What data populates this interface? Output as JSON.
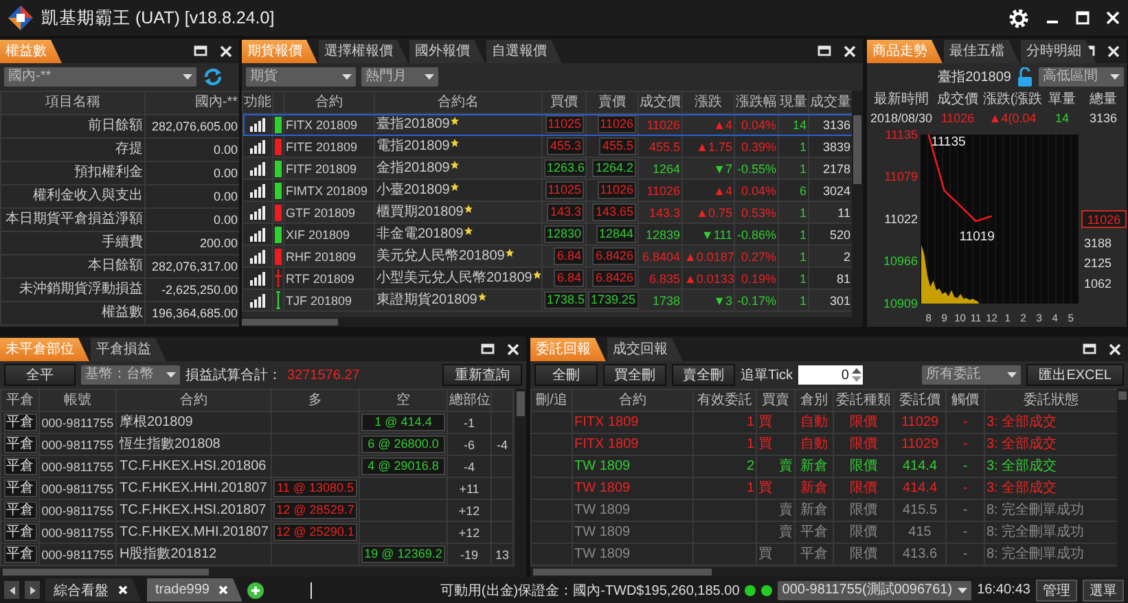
{
  "window": {
    "title": "凱基期霸王 (UAT) [v18.8.24.0]"
  },
  "equity_panel": {
    "tabs": [
      {
        "label": "權益數",
        "selected": true
      }
    ],
    "market_select": {
      "value": "國內-**"
    },
    "columns": [
      "項目名稱",
      "國內-**"
    ],
    "rows": [
      {
        "label": "前日餘額",
        "value": "282,076,605.00"
      },
      {
        "label": "存提",
        "value": "0.00"
      },
      {
        "label": "預扣權利金",
        "value": "0.00"
      },
      {
        "label": "權利金收入與支出",
        "value": "0.00"
      },
      {
        "label": "本日期貨平倉損益淨額",
        "value": "0.00"
      },
      {
        "label": "手續費",
        "value": "200.00"
      },
      {
        "label": "本日餘額",
        "value": "282,076,317.00"
      },
      {
        "label": "未沖銷期貨浮動損益",
        "value": "-2,625,250.00"
      },
      {
        "label": "權益數",
        "value": "196,364,685.00"
      }
    ]
  },
  "quote_panel": {
    "tabs": [
      {
        "label": "期貨報價",
        "selected": true
      },
      {
        "label": "選擇權報價",
        "selected": false
      },
      {
        "label": "國外報價",
        "selected": false
      },
      {
        "label": "自選報價",
        "selected": false
      }
    ],
    "filters": [
      {
        "value": "期貨"
      },
      {
        "value": "熱門月"
      }
    ],
    "columns": [
      "功能",
      "合約",
      "合約名",
      "買價",
      "賣價",
      "成交價",
      "漲跌",
      "漲跌幅",
      "現量",
      "成交量"
    ],
    "rows": [
      {
        "symbol": "FITX 201809",
        "name": "臺指201809",
        "starred": true,
        "color": "#2ed12e",
        "kind": "bar",
        "rising": true,
        "bid": "11025",
        "ask": "11026",
        "last": "11026",
        "change": "▲4",
        "change_pct": "0.04%",
        "tick_volume": "14",
        "volume": "3136",
        "selected": true
      },
      {
        "symbol": "FITE 201809",
        "name": "電指201809",
        "starred": true,
        "color": "#ee1c1c",
        "kind": "bar",
        "rising": true,
        "bid": "455.3",
        "ask": "455.5",
        "last": "455.5",
        "change": "▲1.75",
        "change_pct": "0.39%",
        "tick_volume": "1",
        "volume": "3839",
        "selected": false
      },
      {
        "symbol": "FITF 201809",
        "name": "金指201809",
        "starred": true,
        "color": "#2ed12e",
        "kind": "bar",
        "rising": false,
        "bid": "1263.6",
        "ask": "1264.2",
        "last": "1264",
        "change": "▼7",
        "change_pct": "-0.55%",
        "tick_volume": "1",
        "volume": "2178",
        "selected": false
      },
      {
        "symbol": "FIMTX 201809",
        "name": "小臺201809",
        "starred": true,
        "color": "#2ed12e",
        "kind": "bar",
        "rising": true,
        "bid": "11025",
        "ask": "11026",
        "last": "11026",
        "change": "▲4",
        "change_pct": "0.04%",
        "tick_volume": "6",
        "volume": "3024",
        "selected": false
      },
      {
        "symbol": "GTF 201809",
        "name": "櫃買期201809",
        "starred": true,
        "color": "#ee1c1c",
        "kind": "bar",
        "rising": true,
        "bid": "143.3",
        "ask": "143.65",
        "last": "143.3",
        "change": "▲0.75",
        "change_pct": "0.53%",
        "tick_volume": "1",
        "volume": "11",
        "selected": false
      },
      {
        "symbol": "XIF 201809",
        "name": "非金電201809",
        "starred": true,
        "color": "#2ed12e",
        "kind": "bar",
        "rising": false,
        "bid": "12830",
        "ask": "12844",
        "last": "12839",
        "change": "▼111",
        "change_pct": "-0.86%",
        "tick_volume": "1",
        "volume": "520",
        "selected": false
      },
      {
        "symbol": "RHF 201809",
        "name": "美元兌人民幣201809",
        "starred": true,
        "color": "#ee1c1c",
        "kind": "bar",
        "rising": true,
        "bid": "6.84",
        "ask": "6.8426",
        "last": "6.8404",
        "change": "▲0.0187",
        "change_pct": "0.27%",
        "tick_volume": "1",
        "volume": "2",
        "selected": false
      },
      {
        "symbol": "RTF 201809",
        "name": "小型美元兌人民幣201809",
        "starred": true,
        "color": "#ee1c1c",
        "kind": "cross",
        "rising": true,
        "bid": "6.84",
        "ask": "6.8426",
        "last": "6.835",
        "change": "▲0.0133",
        "change_pct": "0.19%",
        "tick_volume": "1",
        "volume": "81",
        "selected": false
      },
      {
        "symbol": "TJF 201809",
        "name": "東證期貨201809",
        "starred": true,
        "color": "#2ed12e",
        "kind": "line",
        "rising": false,
        "bid": "1738.5",
        "ask": "1739.25",
        "last": "1738",
        "change": "▼3",
        "change_pct": "-0.17%",
        "tick_volume": "1",
        "volume": "301",
        "selected": false
      }
    ]
  },
  "chart_panel": {
    "tabs": [
      {
        "label": "商品走勢",
        "selected": true
      },
      {
        "label": "最佳五檔",
        "selected": false
      },
      {
        "label": "分時明細",
        "selected": false
      }
    ],
    "symbol": "臺指201809",
    "locked": false,
    "range_select": {
      "value": "高低區間"
    },
    "columns": [
      "最新時間",
      "成交價",
      "漲跌(漲跌",
      "單量",
      "總量"
    ],
    "ticker": {
      "time": "2018/08/30",
      "last": "11026",
      "change": "▲4(0.04",
      "tick_volume": "14",
      "total_volume": "3136",
      "rising": true
    },
    "last_price_tag": "11026",
    "chart_data": {
      "type": "line",
      "categories": [
        "8",
        "9",
        "10",
        "11",
        "12",
        "1",
        "2",
        "3",
        "4",
        "5"
      ],
      "ylim": [
        10909,
        11135
      ],
      "yticks": [
        10909,
        10966,
        11022,
        11079,
        11135
      ],
      "series": [
        {
          "color": "#ff1a1a",
          "values": [
            11135,
            11060,
            11040,
            11019,
            11026,
            null,
            null,
            null,
            null,
            null
          ]
        }
      ],
      "annotations": [
        {
          "text": "11135"
        },
        {
          "text": "11019"
        }
      ]
    },
    "volume_axis_labels": [
      "3188",
      "2125",
      "1062"
    ]
  },
  "positions_panel": {
    "tabs": [
      {
        "label": "未平倉部位",
        "selected": true
      },
      {
        "label": "平倉損益",
        "selected": false
      }
    ],
    "close_all_button": "全平",
    "currency_select": {
      "value": "基幣：台幣"
    },
    "pnl_label": "損益試算合計：",
    "pnl_value": "3271576.27",
    "pnl_rising": true,
    "requery_button": "重新查詢",
    "columns": [
      "平倉",
      "帳號",
      "合約",
      "多",
      "空",
      "總部位"
    ],
    "rows": [
      {
        "close_button": "平倉",
        "account": "000-9811755",
        "contract": "摩根201809",
        "long": false,
        "position": "1 @ 414.4",
        "net": "-1"
      },
      {
        "close_button": "平倉",
        "account": "000-9811755",
        "contract": "恆生指數201808",
        "long": false,
        "position": "6 @ 26800.0",
        "net": "-6",
        "column_7": "-4"
      },
      {
        "close_button": "平倉",
        "account": "000-9811755",
        "contract": "TC.F.HKEX.HSI.201806",
        "long": false,
        "position": "4 @ 29016.8",
        "net": "-4"
      },
      {
        "close_button": "平倉",
        "account": "000-9811755",
        "contract": "TC.F.HKEX.HHI.201807",
        "long": true,
        "position": "11 @ 13080.5",
        "net": "+11"
      },
      {
        "close_button": "平倉",
        "account": "000-9811755",
        "contract": "TC.F.HKEX.HSI.201807",
        "long": true,
        "position": "12 @ 28529.7",
        "net": "+12"
      },
      {
        "close_button": "平倉",
        "account": "000-9811755",
        "contract": "TC.F.HKEX.MHI.201807",
        "long": true,
        "position": "12 @ 25290.1",
        "net": "+12"
      },
      {
        "close_button": "平倉",
        "account": "000-9811755",
        "contract": "H股指數201812",
        "long": false,
        "position": "19 @ 12369.2",
        "net": "-19",
        "column_7": "13"
      }
    ]
  },
  "orders_panel": {
    "tabs": [
      {
        "label": "委託回報",
        "selected": true
      },
      {
        "label": "成交回報",
        "selected": false
      }
    ],
    "buttons": [
      "全刪",
      "買全刪",
      "賣全刪"
    ],
    "tick_label": "追單Tick",
    "tick_value": "0",
    "filter_select": {
      "value": "所有委託"
    },
    "export_button": "匯出EXCEL",
    "columns": [
      "刪/追",
      "合約",
      "有效委託",
      "買賣",
      "倉別",
      "委託種類",
      "委託價",
      "觸價",
      "委託狀態"
    ],
    "rows": [
      {
        "contract": "FITX 1809",
        "quantity": "1",
        "side": "買",
        "buy": true,
        "cancelled": false,
        "position_type": "自動",
        "order_type": "限價",
        "price": "11029",
        "trigger": "-",
        "status": "3: 全部成交"
      },
      {
        "contract": "FITX 1809",
        "quantity": "1",
        "side": "買",
        "buy": true,
        "cancelled": false,
        "position_type": "自動",
        "order_type": "限價",
        "price": "11029",
        "trigger": "-",
        "status": "3: 全部成交"
      },
      {
        "contract": "TW 1809",
        "quantity": "2",
        "side": "賣",
        "buy": false,
        "cancelled": false,
        "position_type": "新倉",
        "order_type": "限價",
        "price": "414.4",
        "trigger": "-",
        "status": "3: 全部成交"
      },
      {
        "contract": "TW 1809",
        "quantity": "1",
        "side": "買",
        "buy": true,
        "cancelled": false,
        "position_type": "新倉",
        "order_type": "限價",
        "price": "414.4",
        "trigger": "-",
        "status": "3: 全部成交"
      },
      {
        "contract": "TW 1809",
        "side": "賣",
        "buy": false,
        "cancelled": true,
        "position_type": "新倉",
        "order_type": "限價",
        "price": "415.5",
        "trigger": "-",
        "status": "8: 完全刪單成功"
      },
      {
        "contract": "TW 1809",
        "side": "賣",
        "buy": false,
        "cancelled": true,
        "position_type": "平倉",
        "order_type": "限價",
        "price": "415",
        "trigger": "-",
        "status": "8: 完全刪單成功"
      },
      {
        "contract": "TW 1809",
        "side": "買",
        "buy": true,
        "cancelled": true,
        "position_type": "平倉",
        "order_type": "限價",
        "price": "413.6",
        "trigger": "-",
        "status": "8: 完全刪單成功"
      }
    ]
  },
  "taskbar": {
    "tabs": [
      {
        "label": "綜合看盤",
        "selected": false
      },
      {
        "label": "trade999",
        "selected": true
      }
    ],
    "margin_text": "可動用(出金)保證金：國內-TWD$195,260,185.00",
    "connections": [
      {
        "color": "#22cc22"
      },
      {
        "color": "#22cc22"
      }
    ],
    "account_select": {
      "value": "000-9811755(測試0096761)"
    },
    "time": "16:40:43",
    "buttons": [
      "管理",
      "選單"
    ]
  }
}
